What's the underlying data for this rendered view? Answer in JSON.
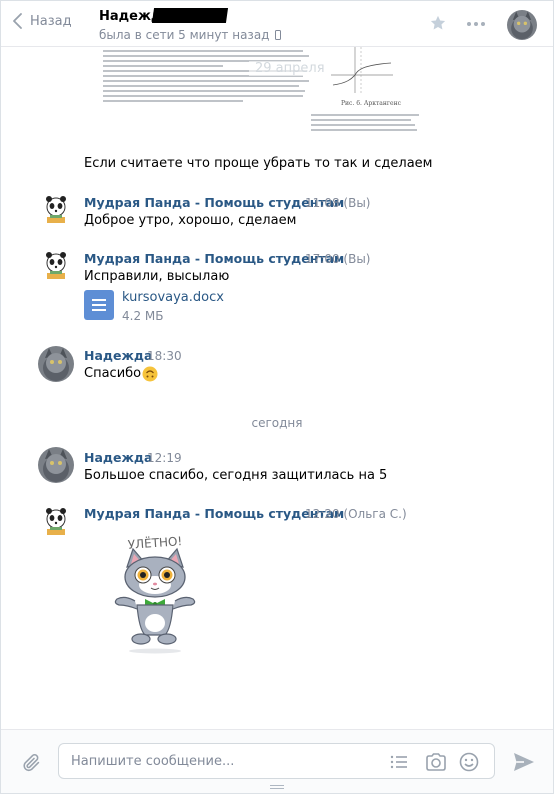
{
  "header": {
    "back_label": "Назад",
    "peer_name": "Надежда",
    "peer_status": "была в сети 5 минут назад"
  },
  "scan": {
    "date_overlay": "29 апреля",
    "figure_caption": "Рис. 6. Арктангенс"
  },
  "messages": [
    {
      "text": "Если считаете что проще убрать то так и сделаем"
    },
    {
      "author": "Мудрая Панда - Помощь студентам",
      "time": "11:08",
      "sender_tag": "(Вы)",
      "text": "Доброе утро, хорошо, сделаем"
    },
    {
      "author": "Мудрая Панда - Помощь студентам",
      "time": "17:00",
      "sender_tag": "(Вы)",
      "text": "Исправили, высылаю",
      "file": {
        "name": "kursovaya.docx",
        "size": "4.2 МБ"
      }
    },
    {
      "author": "Надежда",
      "time": "18:30",
      "text": "Спасибо"
    },
    {
      "author": "Надежда",
      "time": "12:19",
      "text": "Большое спасибо, сегодня защитилась на 5"
    },
    {
      "author": "Мудрая Панда - Помощь студентам",
      "time": "12:20",
      "sender_tag": "(Ольга С.)",
      "sticker_text": "УЛЁТНО!"
    }
  ],
  "day_separator": "сегодня",
  "composer": {
    "placeholder": "Напишите сообщение..."
  },
  "colors": {
    "link": "#2a5885",
    "muted": "#828a99",
    "file_icon": "#5e8ed5",
    "panel": "#fafbfc"
  },
  "icons": [
    "back-chevron-icon",
    "star-icon",
    "more-dots-icon",
    "phone-icon",
    "attach-icon",
    "template-list-icon",
    "camera-icon",
    "emoji-icon",
    "send-icon",
    "document-icon",
    "upside-down-face-emoji"
  ]
}
